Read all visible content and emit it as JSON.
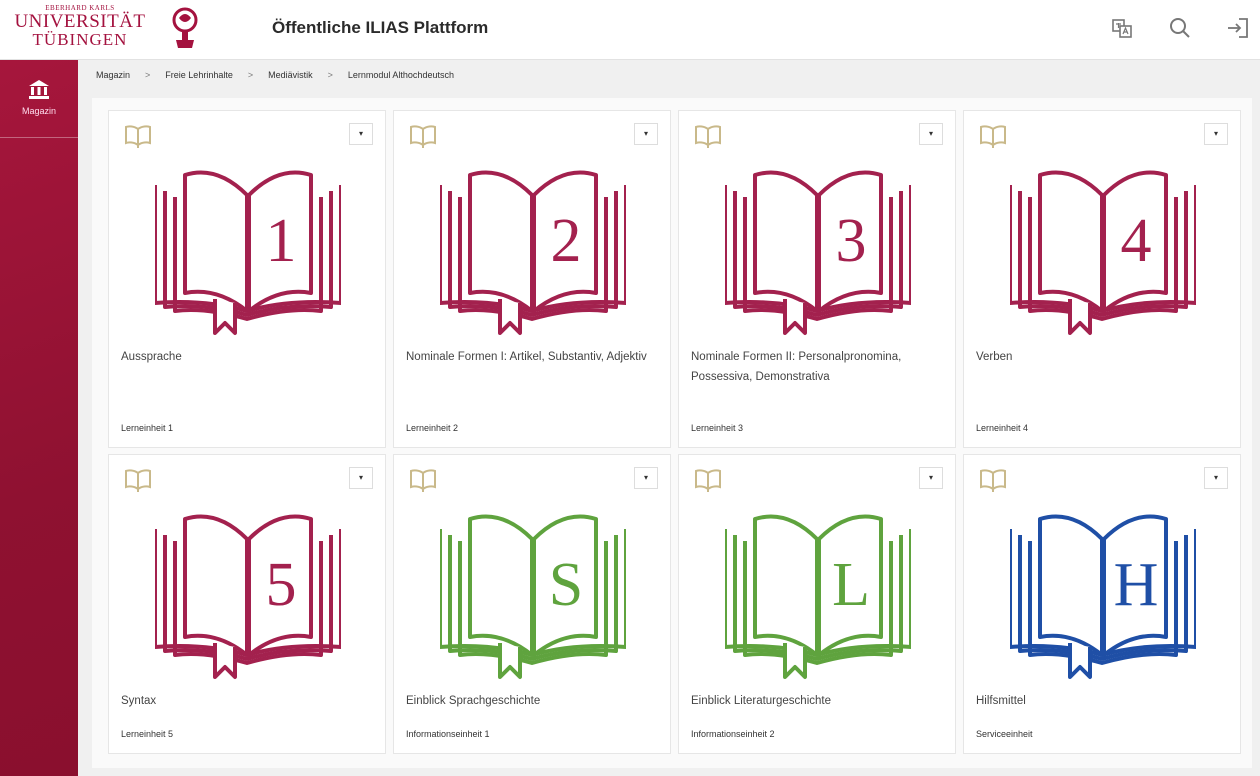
{
  "header": {
    "logo_top": "EBERHARD KARLS",
    "logo_line1": "UNIVERSITÄT",
    "logo_line2": "TÜBINGEN",
    "app_title": "Öffentliche ILIAS Plattform"
  },
  "sidebar": {
    "items": [
      {
        "label": "Magazin",
        "icon": "institution-icon"
      }
    ]
  },
  "breadcrumb": [
    "Magazin",
    "Freie Lehrinhalte",
    "Mediävistik",
    "Lernmodul Althochdeutsch"
  ],
  "cards": [
    {
      "glyph": "1",
      "color": "#a3214e",
      "title": "Aussprache",
      "subtitle": "Lerneinheit 1"
    },
    {
      "glyph": "2",
      "color": "#a3214e",
      "title": "Nominale Formen I: Artikel, Substantiv, Adjektiv",
      "subtitle": "Lerneinheit 2"
    },
    {
      "glyph": "3",
      "color": "#a3214e",
      "title": "Nominale Formen II: Personalpronomina, Possessiva, Demonstrativa",
      "subtitle": "Lerneinheit 3"
    },
    {
      "glyph": "4",
      "color": "#a3214e",
      "title": "Verben",
      "subtitle": "Lerneinheit 4"
    },
    {
      "glyph": "5",
      "color": "#a3214e",
      "title": "Syntax",
      "subtitle": "Lerneinheit 5"
    },
    {
      "glyph": "S",
      "color": "#5fa33e",
      "title": "Einblick Sprachgeschichte",
      "subtitle": "Informationseinheit 1"
    },
    {
      "glyph": "L",
      "color": "#5fa33e",
      "title": "Einblick Literaturgeschichte",
      "subtitle": "Informationseinheit 2"
    },
    {
      "glyph": "H",
      "color": "#1f4fa6",
      "title": "Hilfsmittel",
      "subtitle": "Serviceeinheit"
    }
  ],
  "card_menu_symbol": "▾",
  "colors": {
    "brand": "#a4123f",
    "sidebar": "#9b1437",
    "type_icon": "#c9b98a"
  }
}
